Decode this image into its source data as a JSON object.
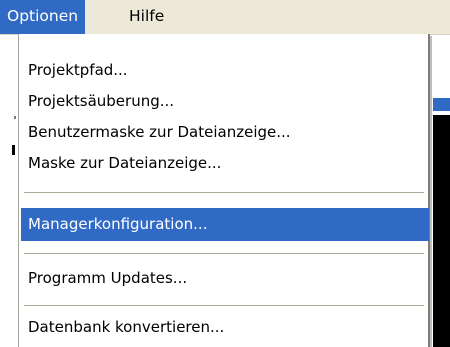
{
  "menubar": {
    "items": [
      {
        "label": "Optionen",
        "active": true
      },
      {
        "label": "Hilfe",
        "active": false
      }
    ]
  },
  "menu": {
    "groups": [
      [
        "Projektpfad...",
        "Projektsäuberung...",
        "Benutzermaske zur Dateianzeige...",
        "Maske zur Dateianzeige..."
      ],
      [
        "Managerkonfiguration..."
      ],
      [
        "Programm Updates..."
      ],
      [
        "Datenbank konvertieren..."
      ]
    ],
    "highlighted_item": "Managerkonfiguration..."
  },
  "colors": {
    "highlight": "#316ac5",
    "menubar_bg": "#ece9d8",
    "menu_bg": "#ffffff",
    "separator": "#aca899"
  }
}
